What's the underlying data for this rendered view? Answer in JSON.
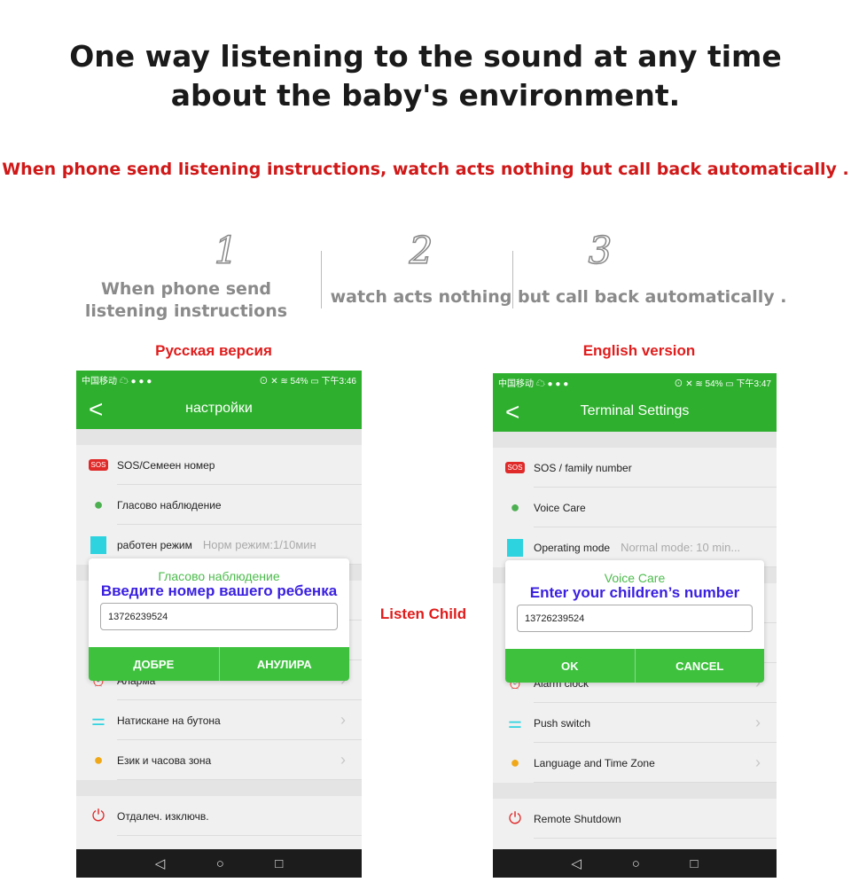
{
  "headline": [
    "One way listening to the sound at any time",
    "about the baby's environment."
  ],
  "subheadline": "When phone send listening instructions, watch acts nothing but call back automatically .",
  "steps": [
    {
      "num": "1",
      "text": "When phone send listening instructions"
    },
    {
      "num": "2",
      "text": "watch acts nothing"
    },
    {
      "num": "3",
      "text": "but call back automatically ."
    }
  ],
  "center_label": "Listen Child",
  "ru": {
    "version": "Русская версия",
    "carrier": "中国移动 ☁ ● ● ●",
    "status": "⊙ ✕ ≋ 54% ▭ 下午3:46",
    "title": "настройки",
    "rows": [
      "SOS/Семеен номер",
      "Гласово наблюдение",
      "работен режим",
      "Аларма",
      "Натискане на бутона",
      "Език и часова зона",
      "Отдалеч. изключв."
    ],
    "mode_value": "Норм режим:1/10мин",
    "dialog": {
      "title": "Гласово наблюдение",
      "prompt": "Введите номер вашего ребенка",
      "number": "13726239524",
      "ok": "ДОБРЕ",
      "cancel": "АНУЛИРА"
    }
  },
  "en": {
    "version": "English version",
    "carrier": "中国移动 ☁ ● ● ●",
    "status": "⊙ ✕ ≋ 54% ▭ 下午3:47",
    "title": "Terminal Settings",
    "rows": [
      "SOS / family number",
      "Voice Care",
      "Operating mode",
      "Alarm clock",
      "Push switch",
      "Language and Time Zone",
      "Remote Shutdown"
    ],
    "mode_value": "Normal mode: 10 min...",
    "dialog": {
      "title": "Voice Care",
      "prompt": "Enter your children’s number",
      "number": "13726239524",
      "ok": "OK",
      "cancel": "CANCEL"
    }
  },
  "colors": {
    "green": "#2eb02e",
    "red": "#d01818",
    "prompt": "#3a20e0"
  }
}
